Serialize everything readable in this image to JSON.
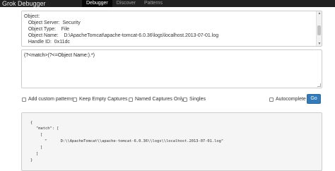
{
  "navbar": {
    "brand": "Grok Debugger",
    "items": [
      {
        "label": "Debugger",
        "active": true
      },
      {
        "label": "Discover",
        "active": false
      },
      {
        "label": "Patterns",
        "active": false
      }
    ]
  },
  "log_input": {
    "lines": [
      "Object:",
      "   Object Server:  Security",
      "   Object Type:    File",
      "   Object Name:    D:\\ApacheTomcat\\apache-tomcat-6.0.36\\logs\\localhost.2013-07-01.log",
      "   Handle ID:  0x11dc"
    ]
  },
  "pattern_input": {
    "value": "(?<match>(?<=Object Name:).*)"
  },
  "options": {
    "add_custom_patterns": "Add custom patterns",
    "keep_empty_captures": "Keep Empty Captures",
    "named_captures_only": "Named Captures Only",
    "singles": "Singles",
    "autocomplete": "Autocomplete"
  },
  "go_button": "Go",
  "result": {
    "lines": [
      "{",
      "\"match\": [",
      "[",
      "\"      D:\\\\ApacheTomcat\\\\apache-tomcat-6.0.36\\\\logs\\\\localhost.2013-07-01.log\"",
      "]",
      "]",
      "}"
    ]
  },
  "colors": {
    "navbar_bg": "#222222",
    "active_tab_bg": "#080808",
    "go_button_bg": "#337ab7",
    "result_bg": "#f5f5f5"
  }
}
